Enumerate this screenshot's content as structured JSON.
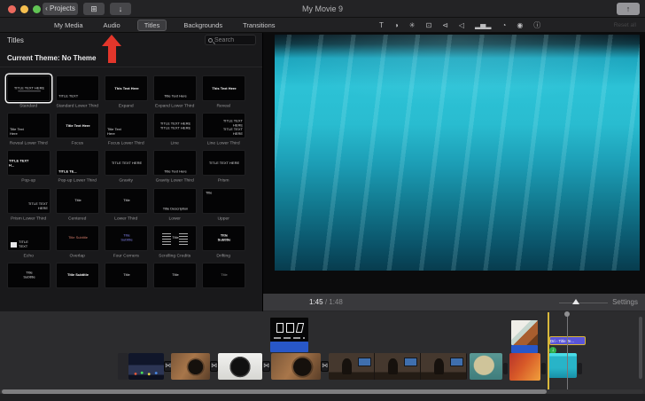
{
  "window": {
    "title": "My Movie 9",
    "projects_button": "Projects",
    "import_icon": "⊞",
    "download_icon": "↓",
    "share_icon": "↑"
  },
  "tabs": {
    "items": [
      {
        "label": "My Media",
        "selected": false
      },
      {
        "label": "Audio",
        "selected": false
      },
      {
        "label": "Titles",
        "selected": true
      },
      {
        "label": "Backgrounds",
        "selected": false
      },
      {
        "label": "Transitions",
        "selected": false
      }
    ]
  },
  "viewer_toolbar": {
    "reset_label": "Reset all",
    "icons": [
      {
        "name": "titles-settings-icon",
        "glyph": "T"
      },
      {
        "name": "color-balance-icon",
        "glyph": "◑"
      },
      {
        "name": "color-correction-icon",
        "glyph": "✳"
      },
      {
        "name": "crop-icon",
        "glyph": "⊡"
      },
      {
        "name": "stabilization-icon",
        "glyph": "⊲"
      },
      {
        "name": "volume-icon",
        "glyph": "◁"
      },
      {
        "name": "noise-reduction-icon",
        "glyph": "▂▅▂"
      },
      {
        "name": "speed-icon",
        "glyph": "◔"
      },
      {
        "name": "clip-filter-icon",
        "glyph": "◉"
      },
      {
        "name": "info-icon",
        "glyph": "ⓘ"
      }
    ]
  },
  "browser": {
    "panel_title": "Titles",
    "search_placeholder": "Search",
    "theme_line": "Current Theme: No Theme",
    "titles": [
      {
        "label": "Standard",
        "prev": "TITLE TEXT HERE",
        "pos": "c",
        "kind": "rule",
        "selected": true
      },
      {
        "label": "Standard Lower Third",
        "prev": "TITLE TEXT",
        "pos": "ll"
      },
      {
        "label": "Expand",
        "prev": "This Text Here",
        "pos": "c",
        "kind": "bold"
      },
      {
        "label": "Expand Lower Third",
        "prev": "Title Text Here",
        "pos": "lc"
      },
      {
        "label": "Reveal",
        "prev": "This Text Here",
        "pos": "c",
        "kind": "bold"
      },
      {
        "label": "Reveal Lower Third",
        "prev": "Title Text Here",
        "pos": "ll"
      },
      {
        "label": "Focus",
        "prev": "Title Text Here",
        "pos": "c",
        "kind": "bold"
      },
      {
        "label": "Focus Lower Third",
        "prev": "Title Text Here",
        "pos": "ll"
      },
      {
        "label": "Line",
        "prev": "TITLE TEXT HERE\nTITLE TEXT HERE",
        "pos": "c"
      },
      {
        "label": "Line Lower Third",
        "prev": "TITLE TEXT HERE\nTITLE TEXT HERE",
        "pos": "lr"
      },
      {
        "label": "Pop-up",
        "prev": "TITLE TEXT H...",
        "pos": "cl",
        "kind": "bold"
      },
      {
        "label": "Pop-up Lower Third",
        "prev": "TITLE TE...",
        "pos": "ll",
        "kind": "bold"
      },
      {
        "label": "Gravity",
        "prev": "TITLE TEXT HERE",
        "pos": "c"
      },
      {
        "label": "Gravity Lower Third",
        "prev": "Title Text Here",
        "pos": "lc"
      },
      {
        "label": "Prism",
        "prev": "TITLE TEXT HERE",
        "pos": "c"
      },
      {
        "label": "Prism Lower Third",
        "prev": "TITLE TEXT HERE",
        "pos": "lr"
      },
      {
        "label": "Centered",
        "prev": "Title",
        "pos": "c"
      },
      {
        "label": "Lower Third",
        "prev": "Title",
        "pos": "c"
      },
      {
        "label": "Lower",
        "prev": "Title Description",
        "pos": "lc"
      },
      {
        "label": "Upper",
        "prev": "Title",
        "pos": "ul"
      },
      {
        "label": "Echo",
        "prev": "TITLE TEXT",
        "pos": "ll",
        "kind": "echo"
      },
      {
        "label": "Overlap",
        "prev": "Title Subtitle",
        "pos": "c",
        "color": "#cc7766"
      },
      {
        "label": "Four Corners",
        "prev": "Title\nSubtitle",
        "pos": "c",
        "color": "#8080e8"
      },
      {
        "label": "Scrolling Credits",
        "prev": "Title",
        "pos": "c",
        "kind": "credits"
      },
      {
        "label": "Drifting",
        "prev": "Title\nSubtitle",
        "pos": "c",
        "kind": "bold"
      },
      {
        "label": "",
        "prev": "Title\nSubtitle",
        "pos": "c"
      },
      {
        "label": "",
        "prev": "Title Subtitle",
        "pos": "c",
        "kind": "bold"
      },
      {
        "label": "",
        "prev": "Title",
        "pos": "c"
      },
      {
        "label": "",
        "prev": "Title",
        "pos": "c"
      },
      {
        "label": "",
        "prev": "Title",
        "pos": "c",
        "color": "#888888"
      }
    ]
  },
  "timeline": {
    "timecode_current": "1:45",
    "timecode_total": "/ 1:48",
    "settings_label": "Settings",
    "title_clip_label": "Dri - Title Te...",
    "audio_badge_glyph": "↓",
    "transition_glyph": "⋈"
  },
  "colors": {
    "accent_blue": "#2857c8",
    "title_clip_purple": "#5a55d8",
    "selection_yellow": "#d8b438",
    "playhead_yellow": "#d8b83c",
    "arrow_red": "#e3362b",
    "underwater_teal": "#2cc2d6",
    "clip_orange": "#d85a28",
    "clip_cyan": "#28b4c8"
  }
}
